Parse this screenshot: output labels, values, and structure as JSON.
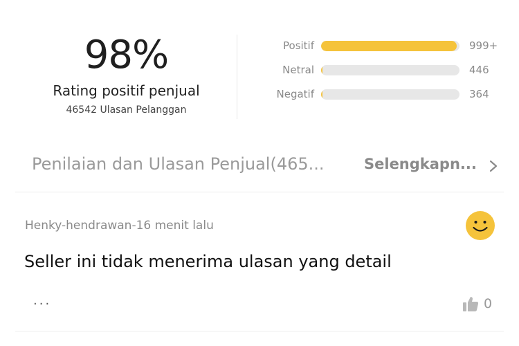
{
  "summary": {
    "percent": "98%",
    "label": "Rating positif penjual",
    "review_count": "46542 Ulasan Pelanggan"
  },
  "ratings": [
    {
      "label": "Positif",
      "count": "999+",
      "fill_fraction": 0.98,
      "color": "#f5c33b"
    },
    {
      "label": "Netral",
      "count": "446",
      "fill_fraction": 0.01,
      "color": "#f5c33b"
    },
    {
      "label": "Negatif",
      "count": "364",
      "fill_fraction": 0.01,
      "color": "#f5c33b"
    }
  ],
  "section": {
    "title": "Penilaian dan Ulasan Penjual(465...",
    "more_label": "Selengkapn...",
    "more_icon": "chevron-right-icon"
  },
  "review": {
    "meta": "Henky-hendrawan-16 menit lalu",
    "text": "Seller ini tidak menerima ulasan yang detail",
    "more": "...",
    "likes": "0",
    "sentiment_icon": "smiley-icon",
    "like_icon": "thumbs-up-icon"
  },
  "colors": {
    "accent": "#f5c33b",
    "track": "#e7e7e7"
  }
}
